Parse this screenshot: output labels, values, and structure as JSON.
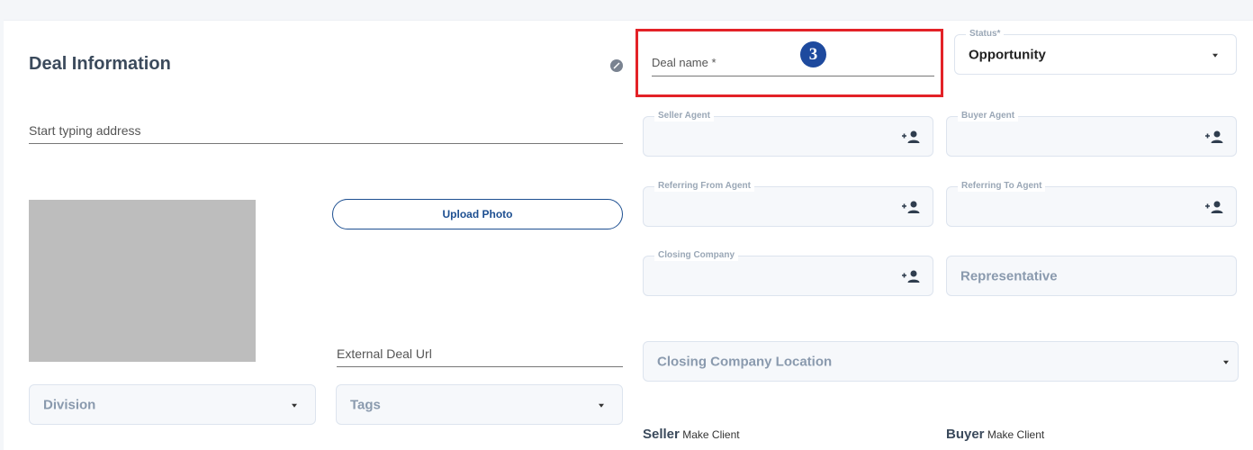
{
  "deal_info": {
    "title": "Deal Information",
    "address_placeholder": "Start typing address",
    "upload_photo_label": "Upload Photo",
    "external_url_placeholder": "External Deal Url",
    "division_placeholder": "Division",
    "tags_placeholder": "Tags"
  },
  "deal_name": {
    "placeholder": "Deal name *",
    "annotation_number": "3"
  },
  "status": {
    "label": "Status*",
    "value": "Opportunity"
  },
  "agents": {
    "seller_agent_label": "Seller Agent",
    "buyer_agent_label": "Buyer Agent",
    "referring_from_label": "Referring From Agent",
    "referring_to_label": "Referring To Agent",
    "closing_company_label": "Closing Company",
    "representative_placeholder": "Representative",
    "closing_location_placeholder": "Closing Company Location"
  },
  "parties": {
    "seller_title": "Seller",
    "seller_action": "Make Client",
    "buyer_title": "Buyer",
    "buyer_action": "Make Client"
  },
  "icons": {
    "add_person": "add-person-icon",
    "info": "info-icon",
    "dropdown": "chevron-down-icon"
  },
  "colors": {
    "accent": "#1d4f91",
    "highlight": "#e32227",
    "badge": "#1e4a9e"
  }
}
